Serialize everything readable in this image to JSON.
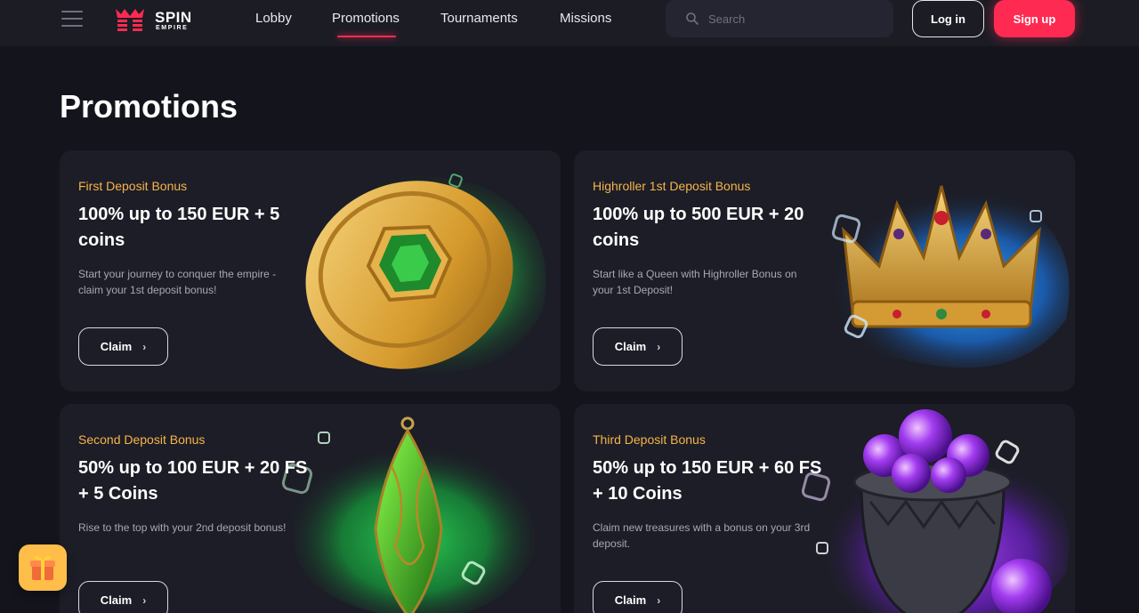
{
  "header": {
    "logo_line1": "SPIN",
    "logo_line2": "EMPIRE",
    "nav": [
      {
        "label": "Lobby"
      },
      {
        "label": "Promotions",
        "active": true
      },
      {
        "label": "Tournaments"
      },
      {
        "label": "Missions"
      }
    ],
    "search_placeholder": "Search",
    "login_label": "Log in",
    "signup_label": "Sign up"
  },
  "page": {
    "title": "Promotions"
  },
  "promos": [
    {
      "label": "First Deposit Bonus",
      "title": "100% up to 150 EUR + 5 coins",
      "desc": "Start your journey to conquer the empire - claim your 1st deposit bonus!",
      "cta": "Claim",
      "art": "gold-coin-emerald"
    },
    {
      "label": "Highroller 1st Deposit Bonus",
      "title": "100% up to 500 EUR + 20 coins",
      "desc": "Start like a Queen with Highroller Bonus on your 1st Deposit!",
      "cta": "Claim",
      "art": "golden-crown"
    },
    {
      "label": "Second Deposit Bonus",
      "title": "50% up to 100 EUR + 20 FS + 5 Coins",
      "desc": "Rise to the top with your 2nd deposit bonus!",
      "cta": "Claim",
      "art": "green-crystal-pendant"
    },
    {
      "label": "Third Deposit Bonus",
      "title": "50% up to 150 EUR + 60 FS + 10 Coins",
      "desc": "Claim new treasures with a bonus on your 3rd deposit.",
      "cta": "Claim",
      "art": "cauldron-purple-orbs"
    }
  ],
  "colors": {
    "background": "#14151c",
    "card": "#1c1d26",
    "accent": "#ff2a52",
    "label": "#f7b44a"
  },
  "icons": {
    "menu": "hamburger-icon",
    "search": "search-icon",
    "claim_chevron": "chevron-right-icon",
    "gift": "gift-icon"
  }
}
